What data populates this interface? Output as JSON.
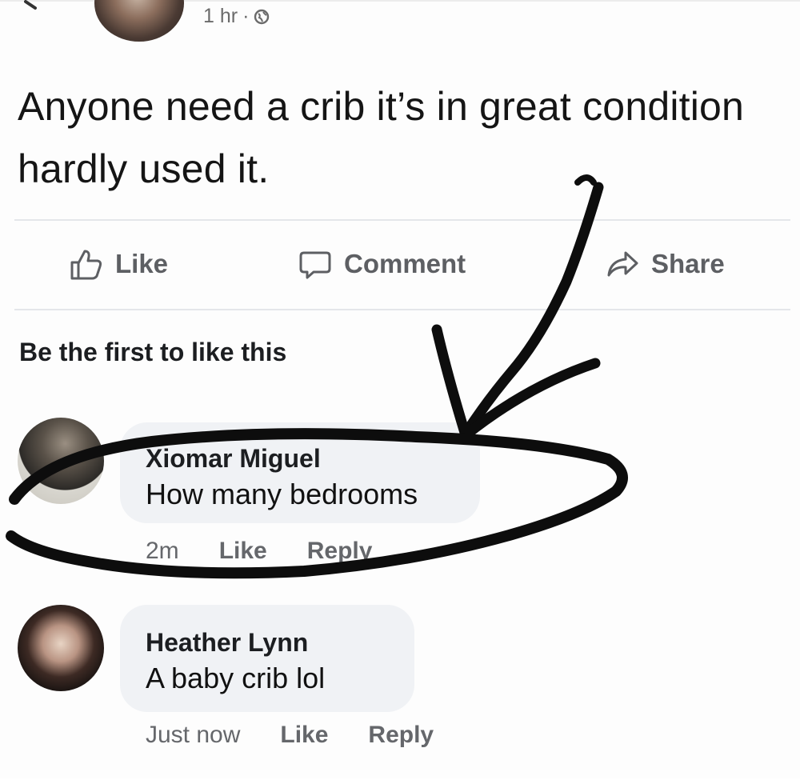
{
  "post": {
    "time": "1 hr",
    "separator": "·",
    "privacy_icon": "globe-icon",
    "text": "Anyone need a crib it’s in great condition hardly used it."
  },
  "actions": {
    "like_label": "Like",
    "comment_label": "Comment",
    "share_label": "Share"
  },
  "reactions": {
    "summary": "Be the first to like this"
  },
  "comments": [
    {
      "author": "Xiomar Miguel",
      "text": "How many bedrooms",
      "time": "2m",
      "like_label": "Like",
      "reply_label": "Reply"
    },
    {
      "author": "Heather Lynn",
      "text": "A baby crib lol",
      "time": "Just now",
      "like_label": "Like",
      "reply_label": "Reply"
    }
  ],
  "colors": {
    "text_primary": "#1c1e21",
    "text_secondary": "#65676b",
    "bubble_bg": "#f0f2f5",
    "divider": "#e4e6ea",
    "marker": "#0d0d0d"
  }
}
